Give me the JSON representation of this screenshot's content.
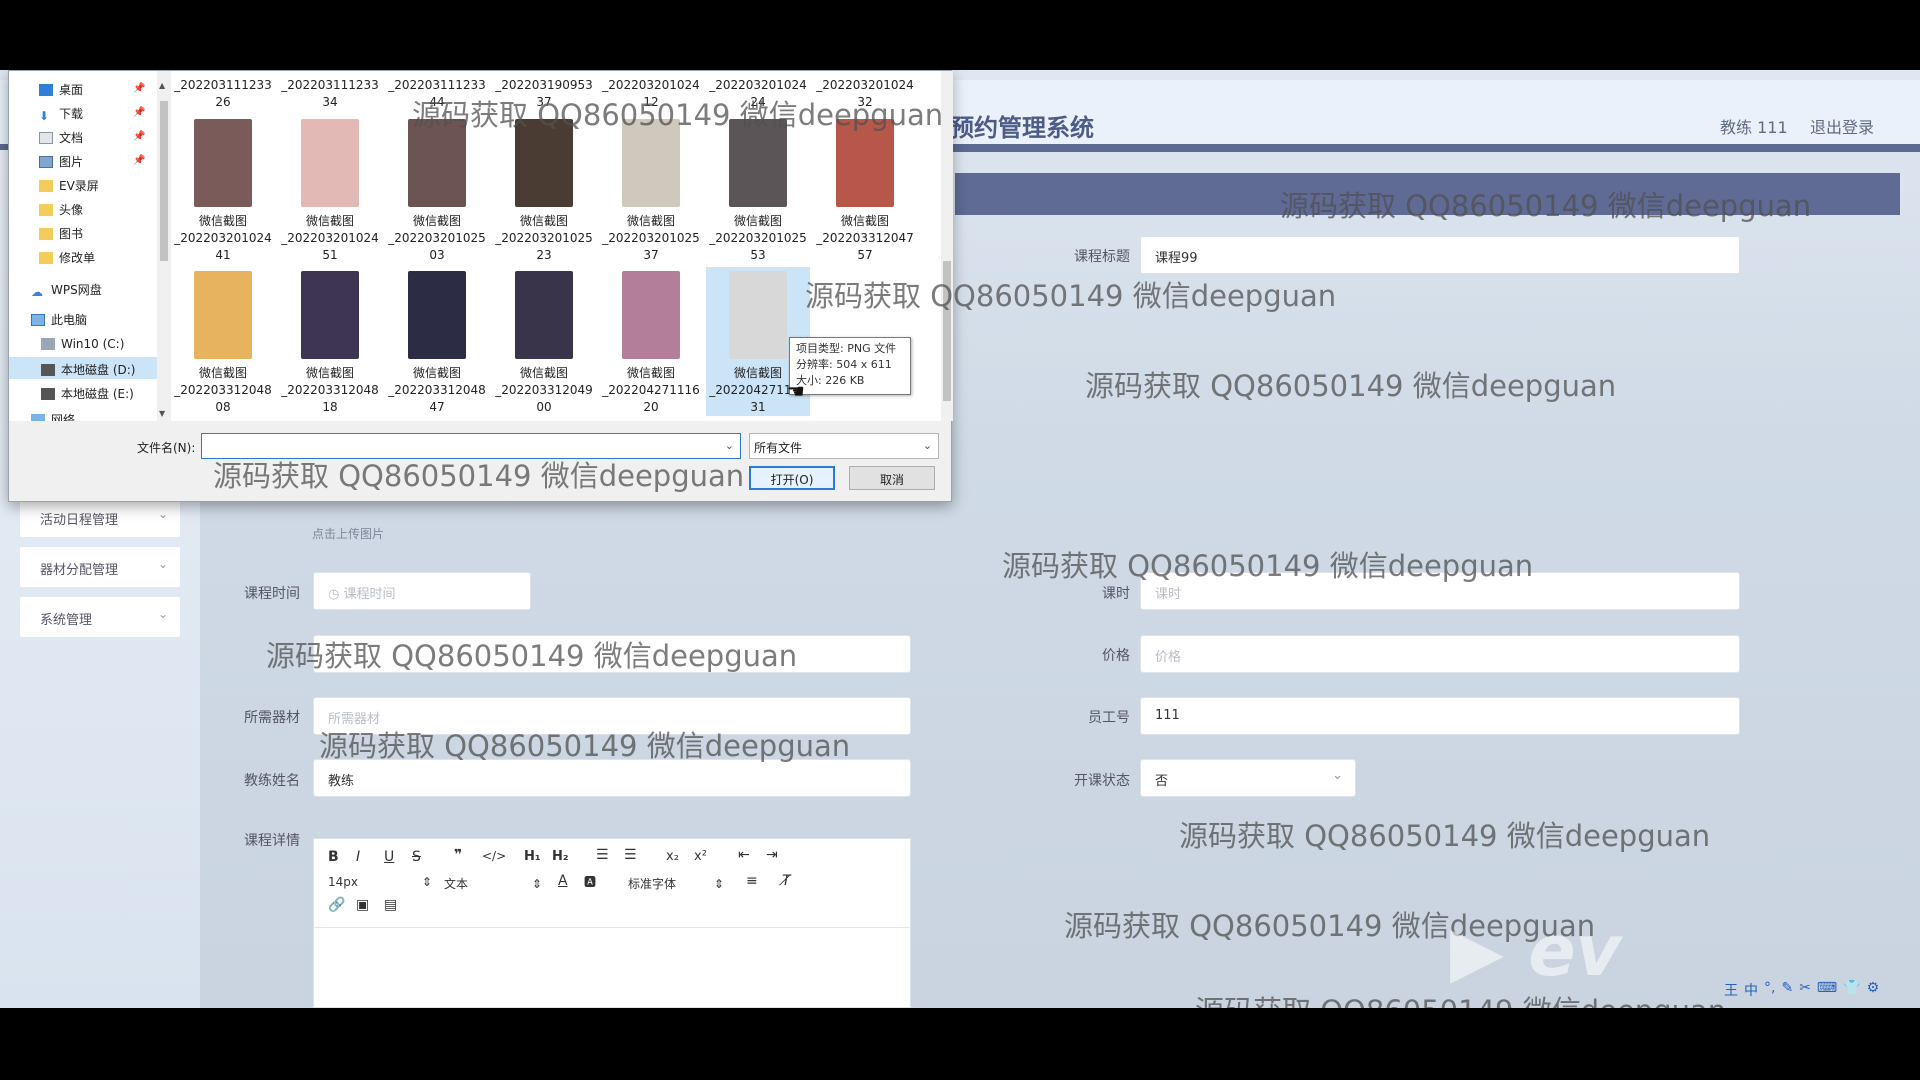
{
  "header": {
    "title": "预约管理系统",
    "user": "教练 111",
    "logout": "退出登录"
  },
  "sidebar": {
    "items": [
      {
        "label": "活动日程管理"
      },
      {
        "label": "器材分配管理"
      },
      {
        "label": "系统管理"
      }
    ]
  },
  "form": {
    "course_title_label": "课程标题",
    "course_title_value": "课程99",
    "upload_hint": "点击上传图片",
    "course_time_label": "课程时间",
    "course_time_placeholder": "课程时间",
    "hours_label": "课时",
    "hours_placeholder": "课时",
    "price_label": "价格",
    "price_placeholder": "价格",
    "equipment_label": "所需器材",
    "equipment_placeholder": "所需器材",
    "staff_no_label": "员工号",
    "staff_no_value": "111",
    "coach_name_label": "教练姓名",
    "coach_name_value": "教练",
    "status_label": "开课状态",
    "status_value": "否",
    "detail_label": "课程详情",
    "editor": {
      "font_size": "14px",
      "block": "文本",
      "font": "标准字体"
    }
  },
  "dialog": {
    "nav": [
      {
        "label": "桌面",
        "pinned": true
      },
      {
        "label": "下载",
        "pinned": true
      },
      {
        "label": "文档",
        "pinned": true
      },
      {
        "label": "图片",
        "pinned": true
      },
      {
        "label": "EV录屏"
      },
      {
        "label": "头像"
      },
      {
        "label": "图书"
      },
      {
        "label": "修改单"
      },
      {
        "label": "WPS网盘"
      },
      {
        "label": "此电脑"
      },
      {
        "label": "Win10 (C:)"
      },
      {
        "label": "本地磁盘 (D:)",
        "selected": true
      },
      {
        "label": "本地磁盘 (E:)"
      },
      {
        "label": "网络"
      }
    ],
    "top_row": [
      {
        "l1": "_202203111233",
        "l2": "26"
      },
      {
        "l1": "_202203111233",
        "l2": "34"
      },
      {
        "l1": "_202203111233",
        "l2": "44"
      },
      {
        "l1": "_202203190953",
        "l2": "37"
      },
      {
        "l1": "_202203201024",
        "l2": "12"
      },
      {
        "l1": "_202203201024",
        "l2": "24"
      },
      {
        "l1": "_202203201024",
        "l2": "32"
      }
    ],
    "row2": [
      {
        "l0": "微信截图",
        "l1": "_202203201024",
        "l2": "41",
        "color": "#7a5b5a"
      },
      {
        "l0": "微信截图",
        "l1": "_202203201024",
        "l2": "51",
        "color": "#e3b9b5"
      },
      {
        "l0": "微信截图",
        "l1": "_202203201025",
        "l2": "03",
        "color": "#6b5452"
      },
      {
        "l0": "微信截图",
        "l1": "_202203201025",
        "l2": "23",
        "color": "#4a3c33"
      },
      {
        "l0": "微信截图",
        "l1": "_202203201025",
        "l2": "37",
        "color": "#cfc8bd"
      },
      {
        "l0": "微信截图",
        "l1": "_202203201025",
        "l2": "53",
        "color": "#5b5558"
      },
      {
        "l0": "微信截图",
        "l1": "_202203312047",
        "l2": "57",
        "color": "#b6574a"
      }
    ],
    "row3": [
      {
        "l0": "微信截图",
        "l1": "_202203312048",
        "l2": "08",
        "color": "#e8b35f"
      },
      {
        "l0": "微信截图",
        "l1": "_202203312048",
        "l2": "18",
        "color": "#3d3552"
      },
      {
        "l0": "微信截图",
        "l1": "_202203312048",
        "l2": "47",
        "color": "#2c2c45"
      },
      {
        "l0": "微信截图",
        "l1": "_202203312049",
        "l2": "00",
        "color": "#3a344b"
      },
      {
        "l0": "微信截图",
        "l1": "_202204271116",
        "l2": "20",
        "color": "#b37f98"
      },
      {
        "l0": "微信截图",
        "l1": "_202204271116",
        "l2": "31",
        "color": "#d8d8d8",
        "selected": true
      }
    ],
    "tooltip": {
      "type": "项目类型: PNG 文件",
      "res": "分辨率: 504 x 611",
      "size": "大小: 226 KB"
    },
    "filename_label": "文件名(N):",
    "filename_value": "",
    "filter": "所有文件",
    "open": "打开(O)",
    "cancel": "取消"
  },
  "watermark": "源码获取 QQ86050149 微信deepguan",
  "ime": [
    "王",
    "中",
    "°,",
    "✎",
    "✂",
    "⌨",
    "👕",
    "⚙"
  ]
}
